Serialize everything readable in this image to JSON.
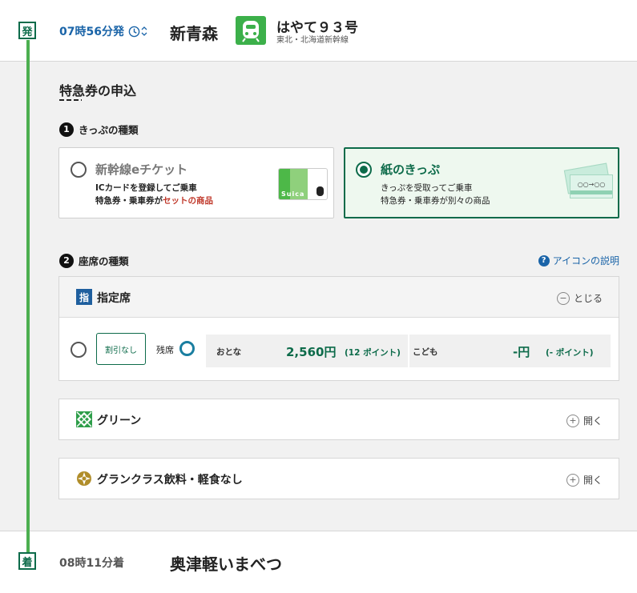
{
  "departure": {
    "badge": "発",
    "time": "07時56分発",
    "station": "新青森",
    "train_name": "はやて９３号",
    "train_line": "東北・北海道新幹線"
  },
  "arrival": {
    "badge": "着",
    "time": "08時11分着",
    "station": "奥津軽いまべつ"
  },
  "section_title": "特急券の申込",
  "step1": {
    "num": "1",
    "label": "きっぷの種類"
  },
  "ticket_options": [
    {
      "title": "新幹線eチケット",
      "line1": "ICカードを登録してご乗車",
      "line2_a": "特急券・乗車券が",
      "line2_b": "セットの商品",
      "selected": false,
      "card_text": "Suica"
    },
    {
      "title": "紙のきっぷ",
      "line1": "きっぷを受取ってご乗車",
      "line2": "特急券・乗車券が別々の商品",
      "selected": true,
      "ticket_text": "○○→○○"
    }
  ],
  "step2": {
    "num": "2",
    "label": "座席の種類"
  },
  "icon_help": "アイコンの説明",
  "seat_reserved": {
    "badge": "指",
    "title": "指定席",
    "toggle": "とじる",
    "discount": "割引なし",
    "availability_label": "残席",
    "adult_label": "おとな",
    "adult_price": "2,560円",
    "adult_points": "(12 ポイント)",
    "child_label": "こども",
    "child_price": "-円",
    "child_points": "(- ポイント)"
  },
  "seat_green": {
    "title": "グリーン",
    "toggle": "開く"
  },
  "seat_granclass": {
    "title": "グランクラス飲料・軽食なし",
    "toggle": "開く"
  },
  "colors": {
    "brand_green": "#0d6b4a",
    "rail_green": "#4caf50",
    "accent_red": "#c0392b",
    "link_blue": "#1a64a8"
  }
}
